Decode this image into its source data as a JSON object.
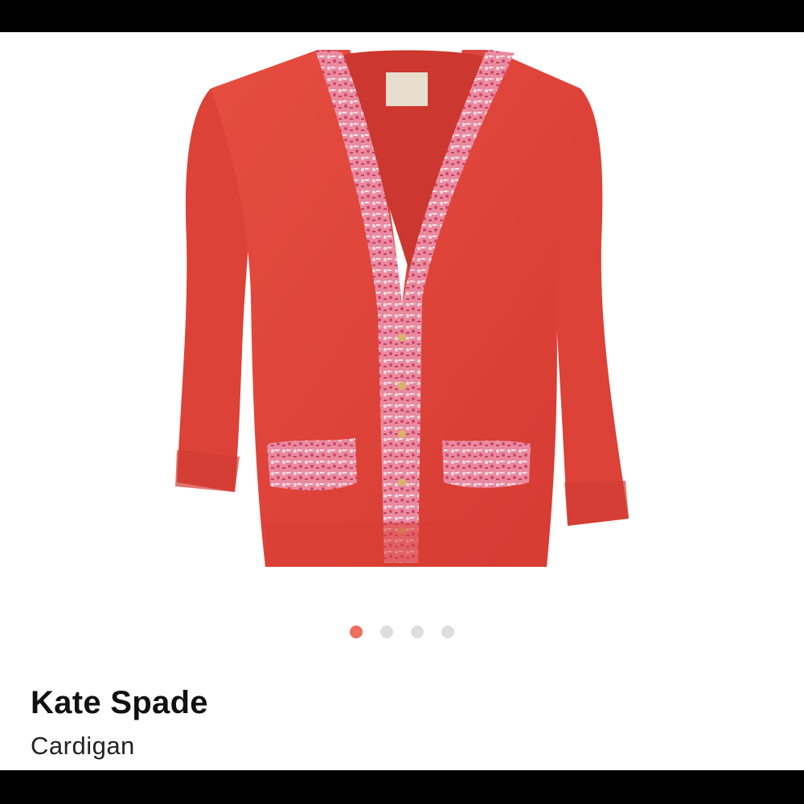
{
  "product": {
    "brand": "Kate Spade",
    "category": "Cardigan",
    "image_subject": "red-knit-cardigan-with-tweed-trim"
  },
  "gallery": {
    "total": 4,
    "active_index": 0,
    "dots": [
      {
        "label": "",
        "active": true
      },
      {
        "label": "",
        "active": false
      },
      {
        "label": "",
        "active": false
      },
      {
        "label": "",
        "active": false
      }
    ]
  },
  "colors": {
    "accent_active_dot": "#ef6f61",
    "inactive_dot": "#dedede",
    "garment": "#e0453a",
    "trim": "#e88aa0"
  }
}
